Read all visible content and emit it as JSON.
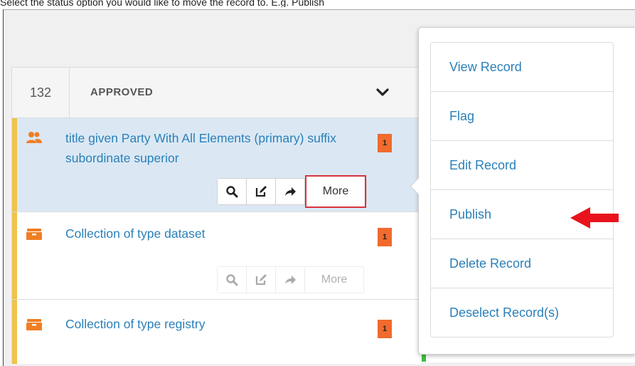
{
  "caption": "Select the status option you would like to move the record to. E.g. Publish",
  "panel": {
    "count": "132",
    "status_title": "APPROVED",
    "records": [
      {
        "title": "title given Party With All Elements (primary) suffix subordinate superior",
        "badge": "1",
        "icon": "party-users-icon",
        "more_label": "More"
      },
      {
        "title": "Collection of type dataset",
        "badge": "1",
        "icon": "collection-box-icon",
        "more_label": "More"
      },
      {
        "title": "Collection of type registry",
        "badge": "1",
        "icon": "collection-box-icon"
      }
    ]
  },
  "menu": {
    "items": [
      "View Record",
      "Flag",
      "Edit Record",
      "Publish",
      "Delete Record",
      "Deselect Record(s)"
    ]
  },
  "right_strip_glyphs": [
    "i",
    "i",
    "i"
  ],
  "colors": {
    "link": "#2a80b9",
    "badge": "#f06b2e",
    "stripe": "#f0c34a",
    "highlight": "#d9333c",
    "pointer_arrow": "#e8131c"
  }
}
